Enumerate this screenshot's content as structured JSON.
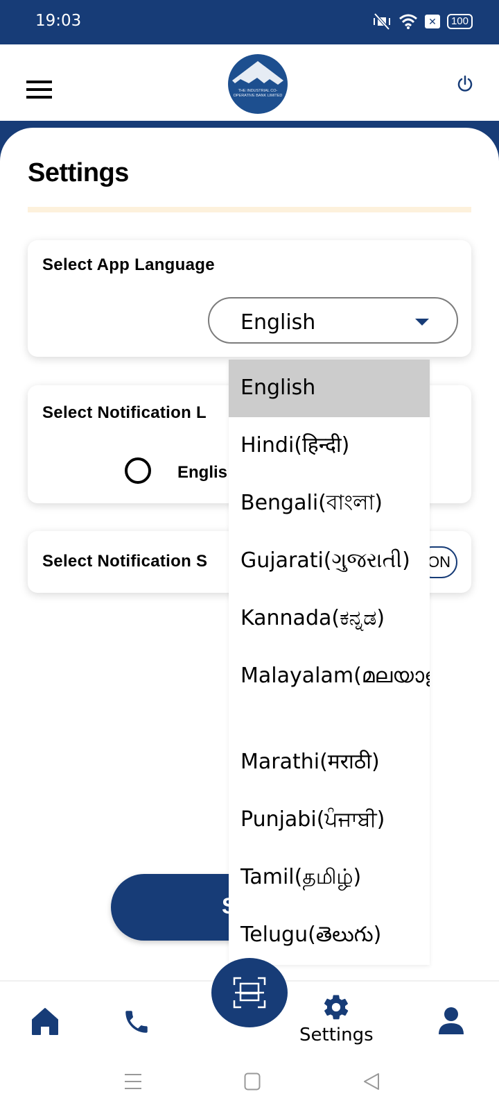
{
  "status_bar": {
    "time": "19:03",
    "battery": "100",
    "icons": [
      "vibrate-mute-icon",
      "wifi-icon",
      "sim-x-icon",
      "battery-icon"
    ]
  },
  "header": {
    "menu_icon": "hamburger-icon",
    "logo_text": "THE INDUSTRIAL CO-OPERATIVE BANK LIMITED",
    "power_icon": "power-icon"
  },
  "page": {
    "title": "Settings"
  },
  "app_language": {
    "label": "Select App Language",
    "selected": "English"
  },
  "notification_language": {
    "label": "Select Notification Language",
    "label_visible": "Select Notification L",
    "option": "English",
    "option_visible": "Englis"
  },
  "notification_sound": {
    "label_visible": "Select Notification S",
    "toggle_visible": "ON"
  },
  "save_button": {
    "label_visible": "S"
  },
  "dropdown": {
    "options": [
      {
        "label": "English",
        "selected": true
      },
      {
        "label": "Hindi(हिन्दी)",
        "selected": false
      },
      {
        "label": "Bengali(বাংলা)",
        "selected": false
      },
      {
        "label": "Gujarati(ગુજરાતી)",
        "selected": false
      },
      {
        "label": "Kannada(ಕನ್ನಡ)",
        "selected": false
      },
      {
        "label": "Malayalam(മലയാളം)",
        "selected": false
      },
      {
        "label": "Marathi(मराठी)",
        "selected": false
      },
      {
        "label": "Punjabi(ਪੰਜਾਬੀ)",
        "selected": false
      },
      {
        "label": "Tamil(தமிழ்)",
        "selected": false
      },
      {
        "label": "Telugu(తెలుగు)",
        "selected": false
      }
    ]
  },
  "bottom_nav": {
    "items": [
      {
        "icon": "home-icon",
        "label": ""
      },
      {
        "icon": "phone-icon",
        "label": ""
      },
      {
        "icon": "scan-icon",
        "label": ""
      },
      {
        "icon": "gear-icon",
        "label": "Settings"
      },
      {
        "icon": "user-icon",
        "label": ""
      }
    ]
  },
  "colors": {
    "primary": "#173c77",
    "divider": "#fdf1dc",
    "selected_item": "#cccccc"
  }
}
